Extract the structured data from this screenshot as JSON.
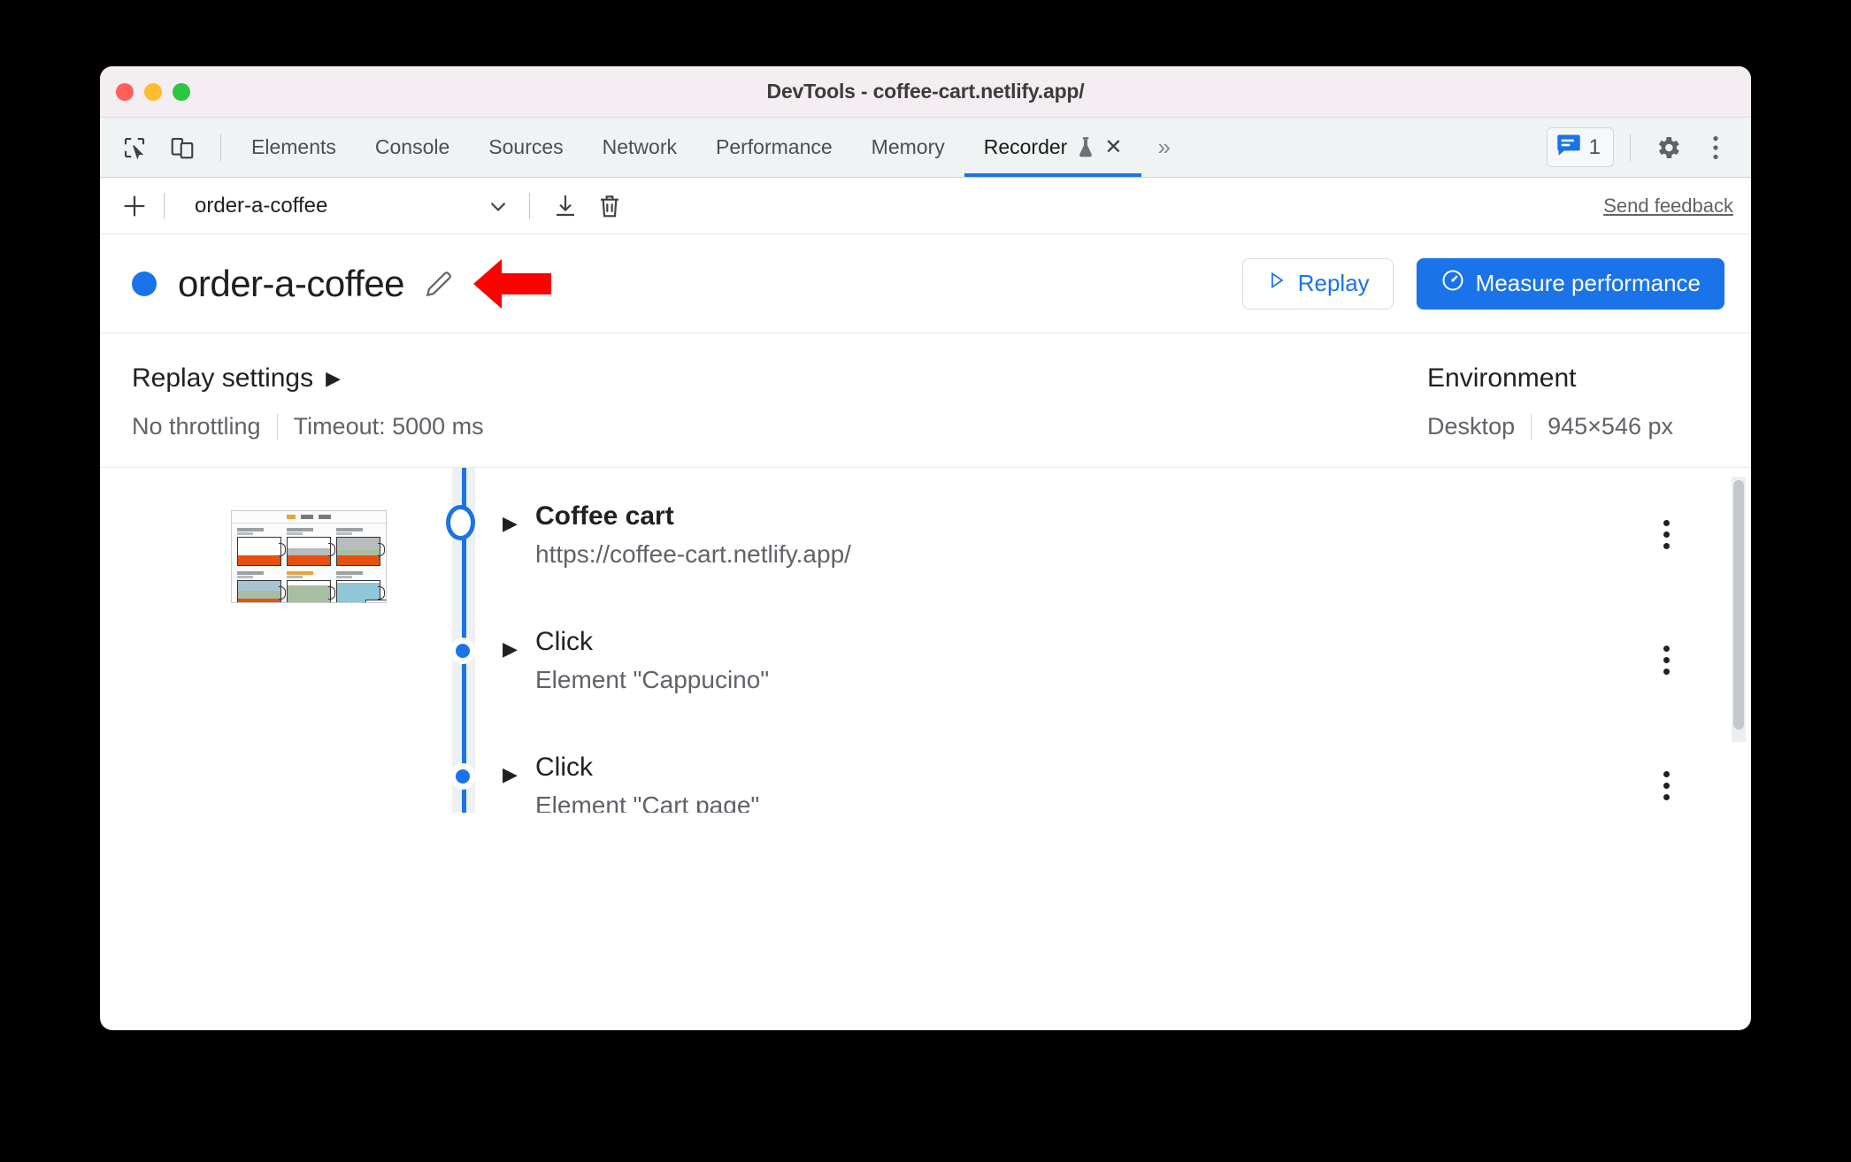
{
  "window": {
    "title": "DevTools - coffee-cart.netlify.app/",
    "traffic_lights": [
      "close-red",
      "minimize-yellow",
      "zoom-green"
    ]
  },
  "tabstrip": {
    "left_icons": [
      {
        "name": "inspect-element-icon",
        "glyph": "cursor-box"
      },
      {
        "name": "device-toolbar-icon",
        "glyph": "device"
      }
    ],
    "tabs": [
      {
        "label": "Elements",
        "active": false
      },
      {
        "label": "Console",
        "active": false
      },
      {
        "label": "Sources",
        "active": false
      },
      {
        "label": "Network",
        "active": false
      },
      {
        "label": "Performance",
        "active": false
      },
      {
        "label": "Memory",
        "active": false
      },
      {
        "label": "Recorder",
        "active": true,
        "experimental": true,
        "closable": true
      }
    ],
    "overflow_label": "»",
    "message_count": "1",
    "right_icons": [
      {
        "name": "settings-gear-icon"
      },
      {
        "name": "more-options-icon"
      }
    ],
    "accent_color": "#1a73e8"
  },
  "recorder_toolbar": {
    "add_label": "+",
    "selected_recording": "order-a-coffee",
    "icons": [
      {
        "name": "export-recording-icon"
      },
      {
        "name": "delete-recording-icon"
      }
    ],
    "feedback_link": "Send feedback"
  },
  "recording_header": {
    "status_dot_color": "#1a73e8",
    "title": "order-a-coffee",
    "edit_icon": "pencil-icon",
    "annotation": "red-arrow-pointing-left",
    "replay_button": "Replay",
    "measure_button": "Measure performance",
    "primary_color": "#1a73e8"
  },
  "replay_settings": {
    "heading": "Replay settings",
    "throttling": "No throttling",
    "timeout": "Timeout: 5000 ms"
  },
  "environment": {
    "heading": "Environment",
    "device": "Desktop",
    "viewport": "945×546 px"
  },
  "steps": [
    {
      "title": "Coffee cart",
      "subtitle": "https://coffee-cart.netlify.app/",
      "marker": "start-ring",
      "bold": true,
      "has_thumbnail": true
    },
    {
      "title": "Click",
      "subtitle": "Element \"Cappucino\"",
      "marker": "dot",
      "bold": false,
      "has_thumbnail": false
    },
    {
      "title": "Click",
      "subtitle": "Element \"Cart page\"",
      "marker": "dot",
      "bold": false,
      "has_thumbnail": false
    }
  ]
}
